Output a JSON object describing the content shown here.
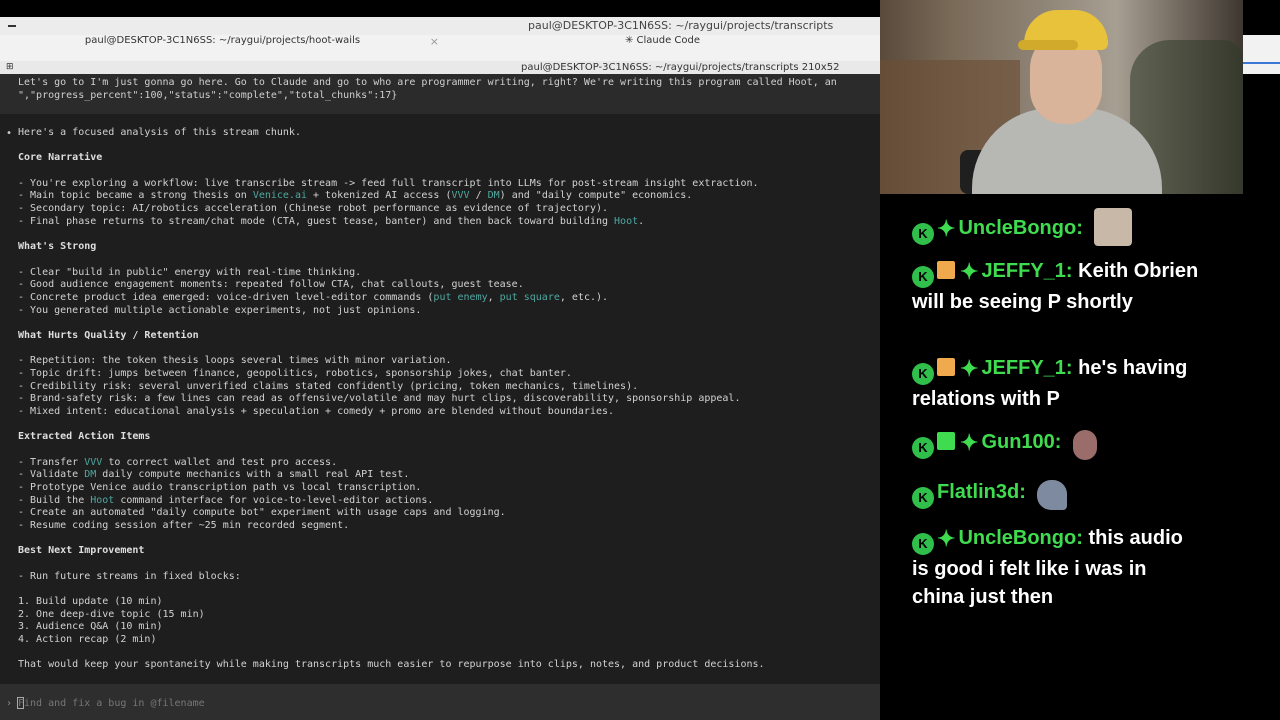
{
  "window": {
    "title": "paul@DESKTOP-3C1N6SS: ~/raygui/projects/transcripts",
    "tabs": [
      {
        "label": "paul@DESKTOP-3C1N6SS: ~/raygui/projects/hoot-wails",
        "close": "×"
      },
      {
        "label": "✳ Claude Code"
      }
    ],
    "size_label": "paul@DESKTOP-3C1N6SS: ~/raygui/projects/transcripts 210x52"
  },
  "terminal": {
    "previous": [
      "Let's go to I'm just gonna go here. Go to Claude and go to who are programmer writing, right? We're writing this program called Hoot, an",
      "\",\"progress_percent\":100,\"status\":\"complete\",\"total_chunks\":17}"
    ],
    "bullet": "•",
    "intro": "Here's a focused analysis of this stream chunk.",
    "sections": {
      "core": {
        "heading": "Core Narrative",
        "l1": "- You're exploring a workflow: live transcribe stream -> feed full transcript into LLMs for post-stream insight extraction.",
        "l2a": "- Main topic became a strong thesis on ",
        "l2b": "Venice.ai",
        "l2c": " + tokenized AI access (",
        "l2d": "VVV",
        "l2e": " / ",
        "l2f": "DM",
        "l2g": ") and \"daily compute\" economics.",
        "l3": "- Secondary topic: AI/robotics acceleration (Chinese robot performance as evidence of trajectory).",
        "l4a": "- Final phase returns to stream/chat mode (CTA, guest tease, banter) and then back toward building ",
        "l4b": "Hoot",
        "l4c": "."
      },
      "strong": {
        "heading": "What's Strong",
        "l1": "- Clear \"build in public\" energy with real-time thinking.",
        "l2": "- Good audience engagement moments: repeated follow CTA, chat callouts, guest tease.",
        "l3a": "- Concrete product idea emerged: voice-driven level-editor commands (",
        "l3b": "put enemy",
        "l3c": ", ",
        "l3d": "put square",
        "l3e": ", etc.).",
        "l4": "- You generated multiple actionable experiments, not just opinions."
      },
      "hurts": {
        "heading": "What Hurts Quality / Retention",
        "l1": "- Repetition: the token thesis loops several times with minor variation.",
        "l2": "- Topic drift: jumps between finance, geopolitics, robotics, sponsorship jokes, chat banter.",
        "l3": "- Credibility risk: several unverified claims stated confidently (pricing, token mechanics, timelines).",
        "l4": "- Brand-safety risk: a few lines can read as offensive/volatile and may hurt clips, discoverability, sponsorship appeal.",
        "l5": "- Mixed intent: educational analysis + speculation + comedy + promo are blended without boundaries."
      },
      "actions": {
        "heading": "Extracted Action Items",
        "l1a": "- Transfer ",
        "l1b": "VVV",
        "l1c": " to correct wallet and test pro access.",
        "l2a": "- Validate ",
        "l2b": "DM",
        "l2c": " daily compute mechanics with a small real API test.",
        "l3": "- Prototype Venice audio transcription path vs local transcription.",
        "l4a": "- Build the ",
        "l4b": "Hoot",
        "l4c": " command interface for voice-to-level-editor actions.",
        "l5": "- Create an automated \"daily compute bot\" experiment with usage caps and logging.",
        "l6": "- Resume coding session after ~25 min recorded segment."
      },
      "next": {
        "heading": "Best Next Improvement",
        "l1": "- Run future streams in fixed blocks:",
        "items": [
          "1. Build update (10 min)",
          "2. One deep-dive topic (15 min)",
          "3. Audience Q&A (10 min)",
          "4. Action recap (2 min)"
        ],
        "closing": "That would keep your spontaneity while making transcripts much easier to repurpose into clips, notes, and product decisions."
      }
    },
    "prompt": {
      "caret": "›",
      "placeholder": "Find and fix a bug in @filename"
    }
  },
  "chat": {
    "messages": [
      {
        "user": "UncleBongo:",
        "text": ""
      },
      {
        "user": "JEFFY_1:",
        "text": "Keith Obrien will be seeing P shortly"
      },
      {
        "user": "JEFFY_1:",
        "text": "he's having relations with P"
      },
      {
        "user": "Gun100:",
        "text": ""
      },
      {
        "user": "Flatlin3d:",
        "text": ""
      },
      {
        "user": "UncleBongo:",
        "text": "this audio is good i felt like i was in china just then"
      }
    ]
  },
  "colors": {
    "terminal_bg": "#1e1e1e",
    "highlight": "#4ea8a0",
    "username": "#3fdc4f"
  }
}
